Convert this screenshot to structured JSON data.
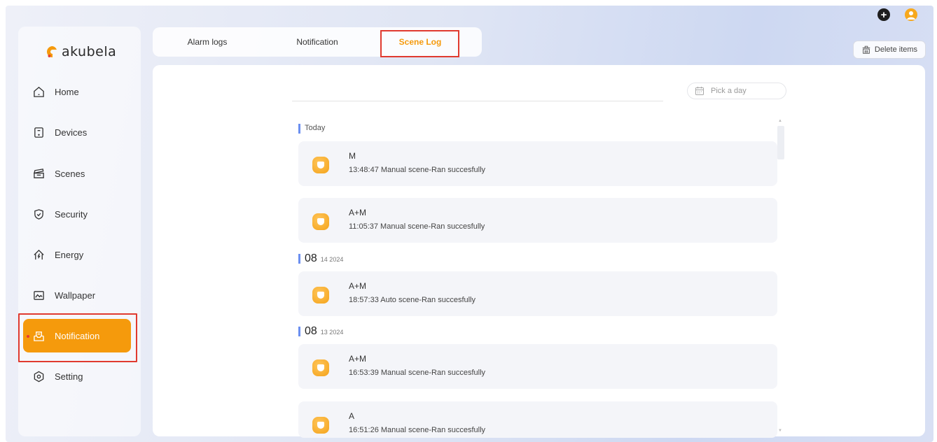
{
  "logo": {
    "text": "akubela"
  },
  "sidebar": {
    "items": [
      {
        "label": "Home",
        "icon": "home-icon"
      },
      {
        "label": "Devices",
        "icon": "devices-icon"
      },
      {
        "label": "Scenes",
        "icon": "scenes-icon"
      },
      {
        "label": "Security",
        "icon": "shield-icon"
      },
      {
        "label": "Energy",
        "icon": "energy-icon"
      },
      {
        "label": "Wallpaper",
        "icon": "wallpaper-icon"
      },
      {
        "label": "Notification",
        "icon": "notification-icon",
        "active": true
      },
      {
        "label": "Setting",
        "icon": "gear-icon"
      }
    ]
  },
  "tabs": [
    {
      "label": "Alarm logs"
    },
    {
      "label": "Notification"
    },
    {
      "label": "Scene Log",
      "active": true
    }
  ],
  "toolbar": {
    "delete_label": "Delete items"
  },
  "date_picker": {
    "placeholder": "Pick a day"
  },
  "sections": [
    {
      "title": "Today"
    },
    {
      "big": "08",
      "small": "14 2024"
    },
    {
      "big": "08",
      "small": "13 2024"
    }
  ],
  "logs": [
    {
      "name": "M",
      "detail": "13:48:47 Manual scene-Ran succesfully"
    },
    {
      "name": "A+M",
      "detail": "11:05:37 Manual scene-Ran succesfully"
    },
    {
      "name": "A+M",
      "detail": "18:57:33 Auto scene-Ran succesfully"
    },
    {
      "name": "A+M",
      "detail": "16:53:39 Manual scene-Ran succesfully"
    },
    {
      "name": "A",
      "detail": "16:51:26 Manual scene-Ran succesfully"
    }
  ],
  "colors": {
    "accent": "#f59a0c",
    "highlight": "#e03a2f",
    "section_bar": "#6b8ff0"
  }
}
